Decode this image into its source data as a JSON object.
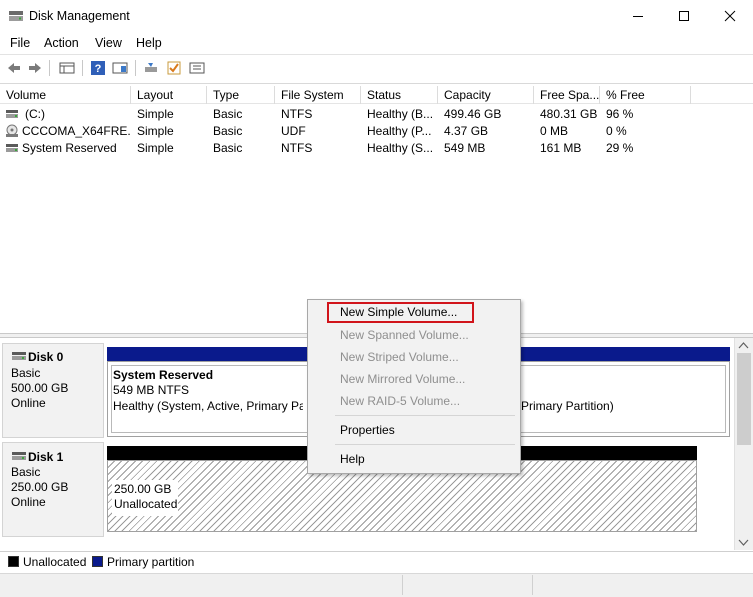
{
  "window": {
    "title": "Disk Management"
  },
  "menu": [
    "File",
    "Action",
    "View",
    "Help"
  ],
  "toolbar": {
    "icons": [
      "back-arrow-icon",
      "forward-arrow-icon",
      "console-tree-icon",
      "help-icon",
      "show-pane-icon",
      "disk-wizard-icon",
      "check-icon",
      "properties-icon"
    ]
  },
  "volume_list": {
    "columns": [
      "Volume",
      "Layout",
      "Type",
      "File System",
      "Status",
      "Capacity",
      "Free Spa...",
      "% Free"
    ],
    "rows": [
      {
        "icon": "drive-icon",
        "volume": "(C:)",
        "layout": "Simple",
        "type": "Basic",
        "fs": "NTFS",
        "status": "Healthy (B...",
        "capacity": "499.46 GB",
        "free": "480.31 GB",
        "pct": "96 %"
      },
      {
        "icon": "cd-drive-icon",
        "volume": "CCCOMA_X64FRE...",
        "layout": "Simple",
        "type": "Basic",
        "fs": "UDF",
        "status": "Healthy (P...",
        "capacity": "4.37 GB",
        "free": "0 MB",
        "pct": "0 %"
      },
      {
        "icon": "drive-icon",
        "volume": "System Reserved",
        "layout": "Simple",
        "type": "Basic",
        "fs": "NTFS",
        "status": "Healthy (S...",
        "capacity": "549 MB",
        "free": "161 MB",
        "pct": "29 %"
      }
    ]
  },
  "disks": [
    {
      "name": "Disk 0",
      "type": "Basic",
      "size": "500.00 GB",
      "state": "Online",
      "partition_title": "System Reserved",
      "partition_size": "549 MB NTFS",
      "partition_status": "Healthy (System, Active, Primary Pa",
      "partition2_status": "Primary Partition)"
    },
    {
      "name": "Disk 1",
      "type": "Basic",
      "size": "250.00 GB",
      "state": "Online",
      "unalloc_size": "250.00 GB",
      "unalloc_label": "Unallocated"
    }
  ],
  "legend": [
    {
      "label": "Unallocated",
      "color": "#000000"
    },
    {
      "label": "Primary partition",
      "color": "#0a1a8c"
    }
  ],
  "context_menu": {
    "new_simple": "New Simple Volume...",
    "new_spanned": "New Spanned Volume...",
    "new_striped": "New Striped Volume...",
    "new_mirrored": "New Mirrored Volume...",
    "new_raid5": "New RAID-5 Volume...",
    "properties": "Properties",
    "help": "Help"
  },
  "colors": {
    "primary_partition": "#0a1a8c",
    "unallocated": "#000000",
    "highlight": "#d1141b"
  }
}
